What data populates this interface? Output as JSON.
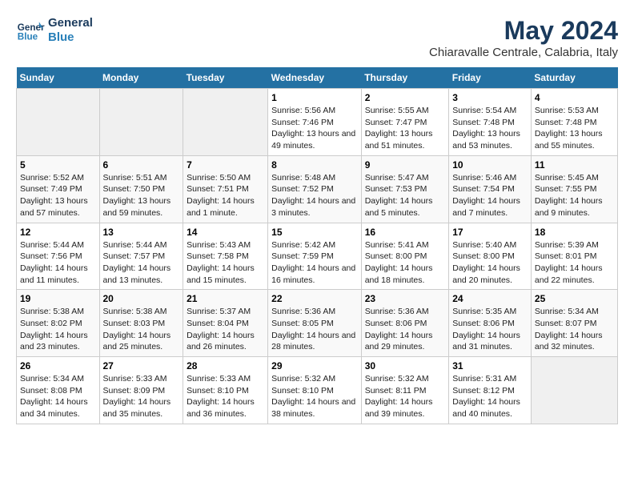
{
  "header": {
    "logo_line1": "General",
    "logo_line2": "Blue",
    "title": "May 2024",
    "subtitle": "Chiaravalle Centrale, Calabria, Italy"
  },
  "days_of_week": [
    "Sunday",
    "Monday",
    "Tuesday",
    "Wednesday",
    "Thursday",
    "Friday",
    "Saturday"
  ],
  "weeks": [
    [
      {
        "num": "",
        "sunrise": "",
        "sunset": "",
        "daylight": ""
      },
      {
        "num": "",
        "sunrise": "",
        "sunset": "",
        "daylight": ""
      },
      {
        "num": "",
        "sunrise": "",
        "sunset": "",
        "daylight": ""
      },
      {
        "num": "1",
        "sunrise": "Sunrise: 5:56 AM",
        "sunset": "Sunset: 7:46 PM",
        "daylight": "Daylight: 13 hours and 49 minutes."
      },
      {
        "num": "2",
        "sunrise": "Sunrise: 5:55 AM",
        "sunset": "Sunset: 7:47 PM",
        "daylight": "Daylight: 13 hours and 51 minutes."
      },
      {
        "num": "3",
        "sunrise": "Sunrise: 5:54 AM",
        "sunset": "Sunset: 7:48 PM",
        "daylight": "Daylight: 13 hours and 53 minutes."
      },
      {
        "num": "4",
        "sunrise": "Sunrise: 5:53 AM",
        "sunset": "Sunset: 7:48 PM",
        "daylight": "Daylight: 13 hours and 55 minutes."
      }
    ],
    [
      {
        "num": "5",
        "sunrise": "Sunrise: 5:52 AM",
        "sunset": "Sunset: 7:49 PM",
        "daylight": "Daylight: 13 hours and 57 minutes."
      },
      {
        "num": "6",
        "sunrise": "Sunrise: 5:51 AM",
        "sunset": "Sunset: 7:50 PM",
        "daylight": "Daylight: 13 hours and 59 minutes."
      },
      {
        "num": "7",
        "sunrise": "Sunrise: 5:50 AM",
        "sunset": "Sunset: 7:51 PM",
        "daylight": "Daylight: 14 hours and 1 minute."
      },
      {
        "num": "8",
        "sunrise": "Sunrise: 5:48 AM",
        "sunset": "Sunset: 7:52 PM",
        "daylight": "Daylight: 14 hours and 3 minutes."
      },
      {
        "num": "9",
        "sunrise": "Sunrise: 5:47 AM",
        "sunset": "Sunset: 7:53 PM",
        "daylight": "Daylight: 14 hours and 5 minutes."
      },
      {
        "num": "10",
        "sunrise": "Sunrise: 5:46 AM",
        "sunset": "Sunset: 7:54 PM",
        "daylight": "Daylight: 14 hours and 7 minutes."
      },
      {
        "num": "11",
        "sunrise": "Sunrise: 5:45 AM",
        "sunset": "Sunset: 7:55 PM",
        "daylight": "Daylight: 14 hours and 9 minutes."
      }
    ],
    [
      {
        "num": "12",
        "sunrise": "Sunrise: 5:44 AM",
        "sunset": "Sunset: 7:56 PM",
        "daylight": "Daylight: 14 hours and 11 minutes."
      },
      {
        "num": "13",
        "sunrise": "Sunrise: 5:44 AM",
        "sunset": "Sunset: 7:57 PM",
        "daylight": "Daylight: 14 hours and 13 minutes."
      },
      {
        "num": "14",
        "sunrise": "Sunrise: 5:43 AM",
        "sunset": "Sunset: 7:58 PM",
        "daylight": "Daylight: 14 hours and 15 minutes."
      },
      {
        "num": "15",
        "sunrise": "Sunrise: 5:42 AM",
        "sunset": "Sunset: 7:59 PM",
        "daylight": "Daylight: 14 hours and 16 minutes."
      },
      {
        "num": "16",
        "sunrise": "Sunrise: 5:41 AM",
        "sunset": "Sunset: 8:00 PM",
        "daylight": "Daylight: 14 hours and 18 minutes."
      },
      {
        "num": "17",
        "sunrise": "Sunrise: 5:40 AM",
        "sunset": "Sunset: 8:00 PM",
        "daylight": "Daylight: 14 hours and 20 minutes."
      },
      {
        "num": "18",
        "sunrise": "Sunrise: 5:39 AM",
        "sunset": "Sunset: 8:01 PM",
        "daylight": "Daylight: 14 hours and 22 minutes."
      }
    ],
    [
      {
        "num": "19",
        "sunrise": "Sunrise: 5:38 AM",
        "sunset": "Sunset: 8:02 PM",
        "daylight": "Daylight: 14 hours and 23 minutes."
      },
      {
        "num": "20",
        "sunrise": "Sunrise: 5:38 AM",
        "sunset": "Sunset: 8:03 PM",
        "daylight": "Daylight: 14 hours and 25 minutes."
      },
      {
        "num": "21",
        "sunrise": "Sunrise: 5:37 AM",
        "sunset": "Sunset: 8:04 PM",
        "daylight": "Daylight: 14 hours and 26 minutes."
      },
      {
        "num": "22",
        "sunrise": "Sunrise: 5:36 AM",
        "sunset": "Sunset: 8:05 PM",
        "daylight": "Daylight: 14 hours and 28 minutes."
      },
      {
        "num": "23",
        "sunrise": "Sunrise: 5:36 AM",
        "sunset": "Sunset: 8:06 PM",
        "daylight": "Daylight: 14 hours and 29 minutes."
      },
      {
        "num": "24",
        "sunrise": "Sunrise: 5:35 AM",
        "sunset": "Sunset: 8:06 PM",
        "daylight": "Daylight: 14 hours and 31 minutes."
      },
      {
        "num": "25",
        "sunrise": "Sunrise: 5:34 AM",
        "sunset": "Sunset: 8:07 PM",
        "daylight": "Daylight: 14 hours and 32 minutes."
      }
    ],
    [
      {
        "num": "26",
        "sunrise": "Sunrise: 5:34 AM",
        "sunset": "Sunset: 8:08 PM",
        "daylight": "Daylight: 14 hours and 34 minutes."
      },
      {
        "num": "27",
        "sunrise": "Sunrise: 5:33 AM",
        "sunset": "Sunset: 8:09 PM",
        "daylight": "Daylight: 14 hours and 35 minutes."
      },
      {
        "num": "28",
        "sunrise": "Sunrise: 5:33 AM",
        "sunset": "Sunset: 8:10 PM",
        "daylight": "Daylight: 14 hours and 36 minutes."
      },
      {
        "num": "29",
        "sunrise": "Sunrise: 5:32 AM",
        "sunset": "Sunset: 8:10 PM",
        "daylight": "Daylight: 14 hours and 38 minutes."
      },
      {
        "num": "30",
        "sunrise": "Sunrise: 5:32 AM",
        "sunset": "Sunset: 8:11 PM",
        "daylight": "Daylight: 14 hours and 39 minutes."
      },
      {
        "num": "31",
        "sunrise": "Sunrise: 5:31 AM",
        "sunset": "Sunset: 8:12 PM",
        "daylight": "Daylight: 14 hours and 40 minutes."
      },
      {
        "num": "",
        "sunrise": "",
        "sunset": "",
        "daylight": ""
      }
    ]
  ]
}
